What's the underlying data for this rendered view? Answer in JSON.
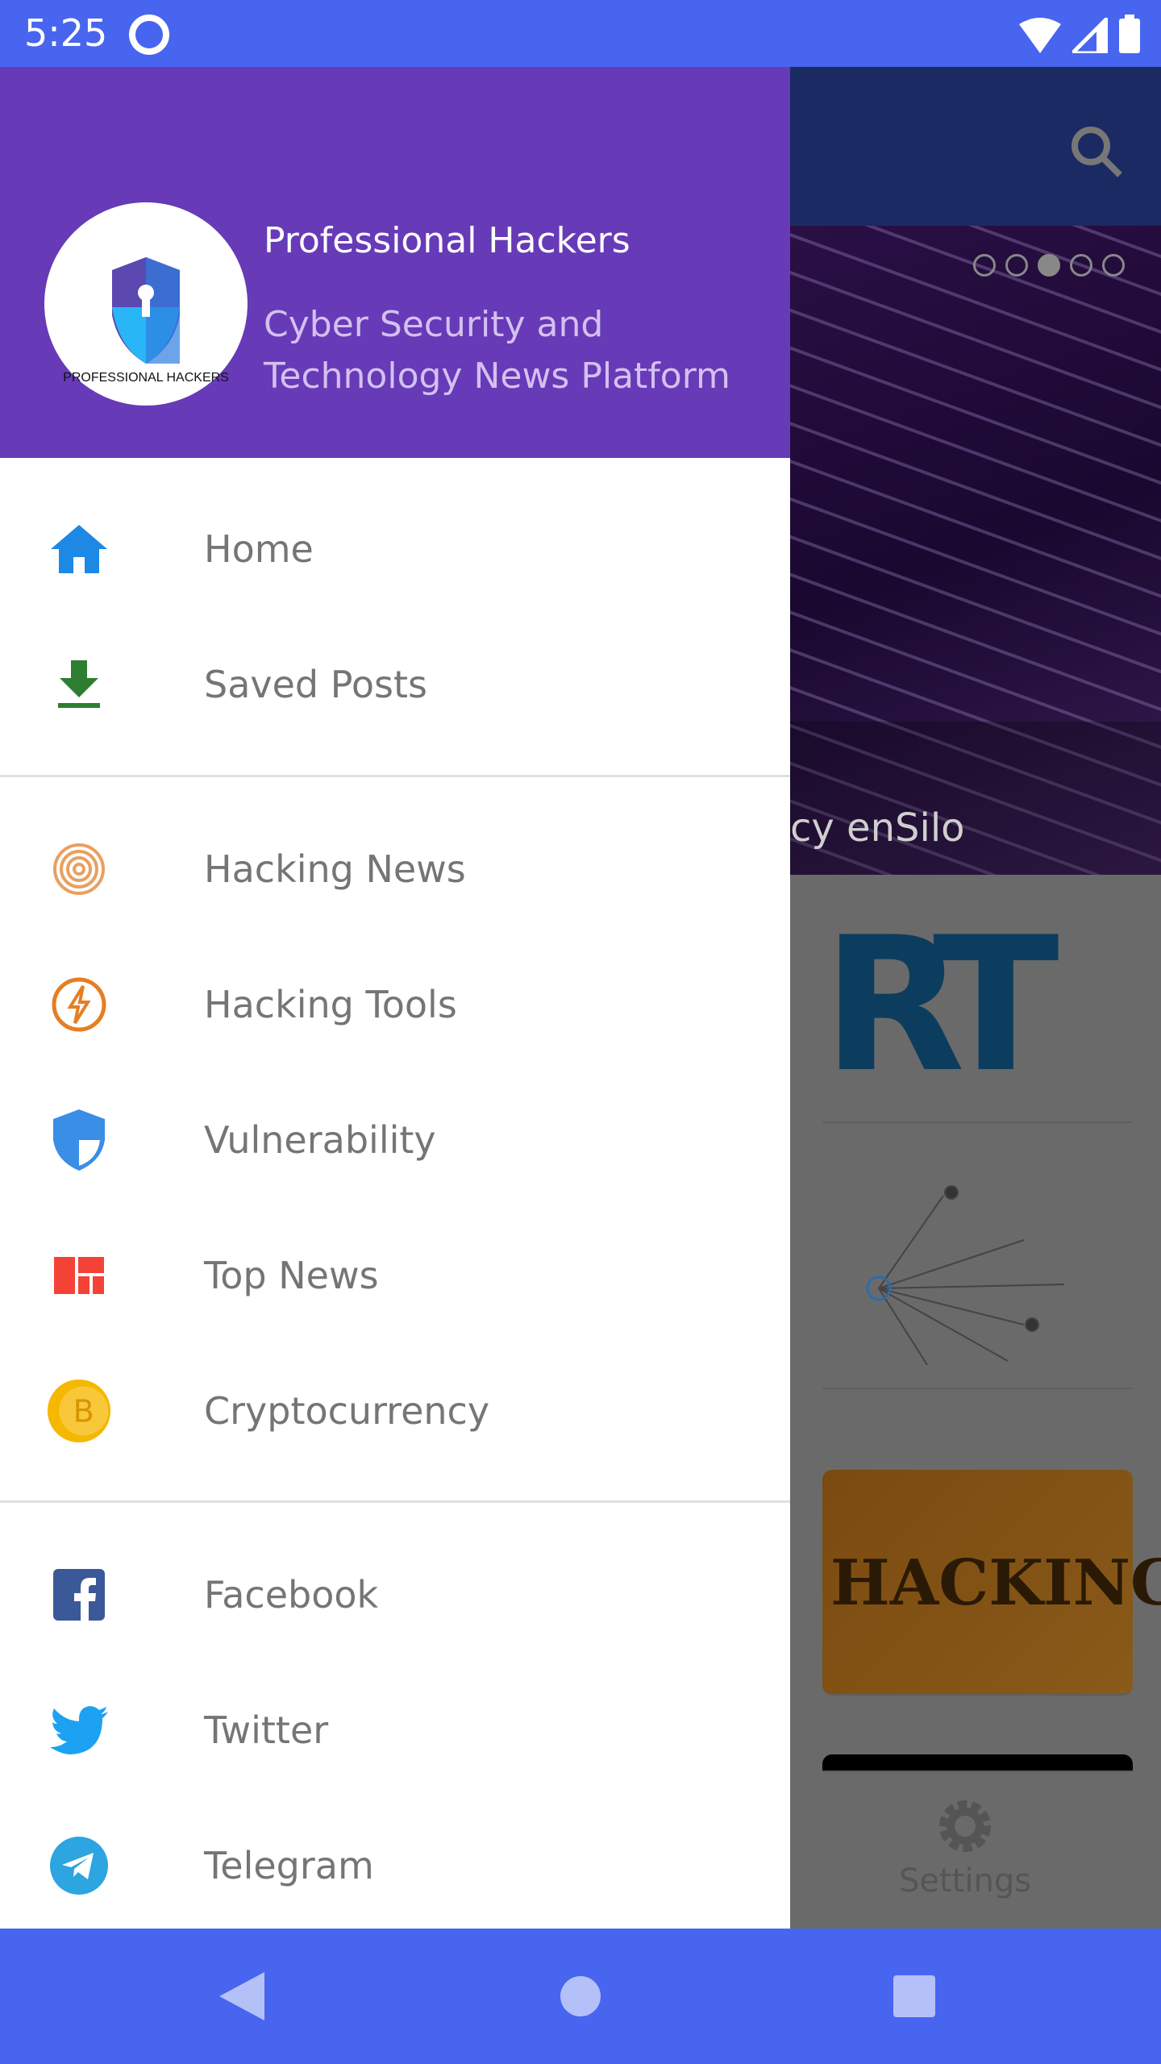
{
  "status_bar": {
    "time": "5:25"
  },
  "drawer": {
    "header": {
      "title": "Professional Hackers",
      "subtitle_line1": "Cyber Security and",
      "subtitle_line2": "Technology News Platform",
      "logo_text": "PROFESSIONAL HACKERS ON SECURITY"
    },
    "items": [
      {
        "label": "Home",
        "icon": "home-icon",
        "color": "#1e88e5"
      },
      {
        "label": "Saved Posts",
        "icon": "download-icon",
        "color": "#2e7d32"
      },
      {
        "label": "Hacking News",
        "icon": "fingerprint-icon",
        "color": "#e8a060"
      },
      {
        "label": "Hacking Tools",
        "icon": "lightning-icon",
        "color": "#e67e22"
      },
      {
        "label": "Vulnerability",
        "icon": "shield-icon",
        "color": "#3a8ee6"
      },
      {
        "label": "Top News",
        "icon": "dashboard-icon",
        "color": "#f44336"
      },
      {
        "label": "Cryptocurrency",
        "icon": "bitcoin-icon",
        "color": "#f5b800"
      },
      {
        "label": "Facebook",
        "icon": "facebook-icon",
        "color": "#3b5998"
      },
      {
        "label": "Twitter",
        "icon": "twitter-icon",
        "color": "#1da1f2"
      },
      {
        "label": "Telegram",
        "icon": "telegram-icon",
        "color": "#2ca5e0"
      }
    ]
  },
  "background": {
    "slider_caption": "cy enSilo",
    "slider_page": 3,
    "slider_total": 5,
    "card1_logo": "RT",
    "card3_text": "HACKING",
    "settings_label": "Settings"
  },
  "colors": {
    "status_bar": "#4765ee",
    "drawer_header": "#673ab7"
  }
}
